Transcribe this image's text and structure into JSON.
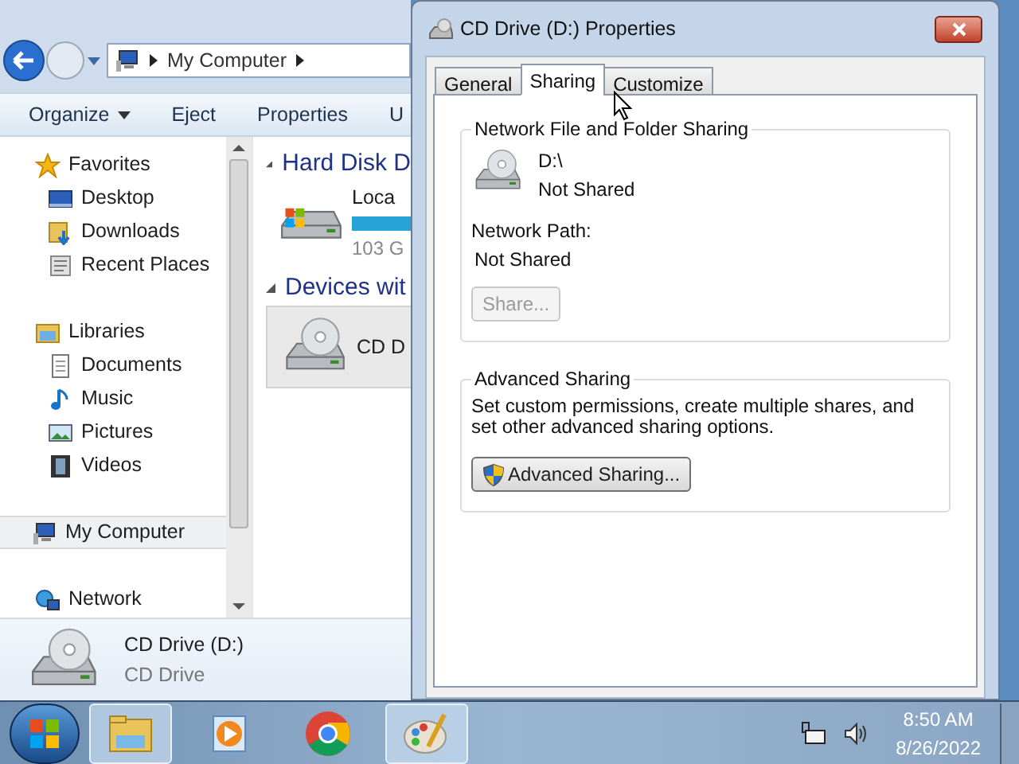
{
  "explorer": {
    "address": "My Computer",
    "toolbar": [
      {
        "label": "Organize",
        "menu": true
      },
      {
        "label": "Eject",
        "menu": false
      },
      {
        "label": "Properties",
        "menu": false
      },
      {
        "label": "U",
        "menu": false
      }
    ],
    "navigation": [
      {
        "label": "Favorites",
        "kind": "star",
        "selected": false,
        "children": [
          {
            "label": "Desktop",
            "kind": "desktop",
            "selected": false
          },
          {
            "label": "Downloads",
            "kind": "downloads",
            "selected": false
          },
          {
            "label": "Recent Places",
            "kind": "recent",
            "selected": false
          }
        ]
      },
      {
        "label": "Libraries",
        "kind": "library",
        "selected": false,
        "children": [
          {
            "label": "Documents",
            "kind": "document",
            "selected": false
          },
          {
            "label": "Music",
            "kind": "music",
            "selected": false
          },
          {
            "label": "Pictures",
            "kind": "pictures",
            "selected": false
          },
          {
            "label": "Videos",
            "kind": "videos",
            "selected": false
          }
        ]
      },
      {
        "label": "My Computer",
        "kind": "computer",
        "selected": true
      },
      {
        "label": "Network",
        "kind": "network",
        "selected": false
      }
    ],
    "groups": [
      {
        "title": "Hard Disk D",
        "items": [
          {
            "name": "Loca",
            "size": "103 G",
            "kind": "hdd",
            "selected": false
          }
        ]
      },
      {
        "title": "Devices wit",
        "items": [
          {
            "name": "CD D",
            "kind": "cd",
            "selected": true
          }
        ]
      }
    ],
    "details": {
      "name": "CD Drive (D:)",
      "type": "CD Drive"
    }
  },
  "dialog": {
    "title": "CD Drive (D:) Properties",
    "tabs": [
      {
        "label": "General",
        "selected": false
      },
      {
        "label": "Sharing",
        "selected": true
      },
      {
        "label": "Customize",
        "selected": false
      }
    ],
    "network_sharing": {
      "legend": "Network File and Folder Sharing",
      "drive": "D:\\",
      "status": "Not Shared",
      "path_label": "Network Path:",
      "path": "Not Shared",
      "button": {
        "label": "Share...",
        "disabled": true
      }
    },
    "advanced_sharing": {
      "legend": "Advanced Sharing",
      "description": "Set custom permissions, create multiple shares, and set other advanced sharing options.",
      "button": {
        "label": "Advanced Sharing...",
        "disabled": false
      }
    }
  },
  "taskbar": {
    "apps": [
      {
        "kind": "explorer",
        "active": true
      },
      {
        "kind": "media",
        "active": false
      },
      {
        "kind": "chrome",
        "active": false
      },
      {
        "kind": "paint",
        "active": true
      }
    ],
    "time": "8:50 AM",
    "date": "8/26/2022"
  }
}
